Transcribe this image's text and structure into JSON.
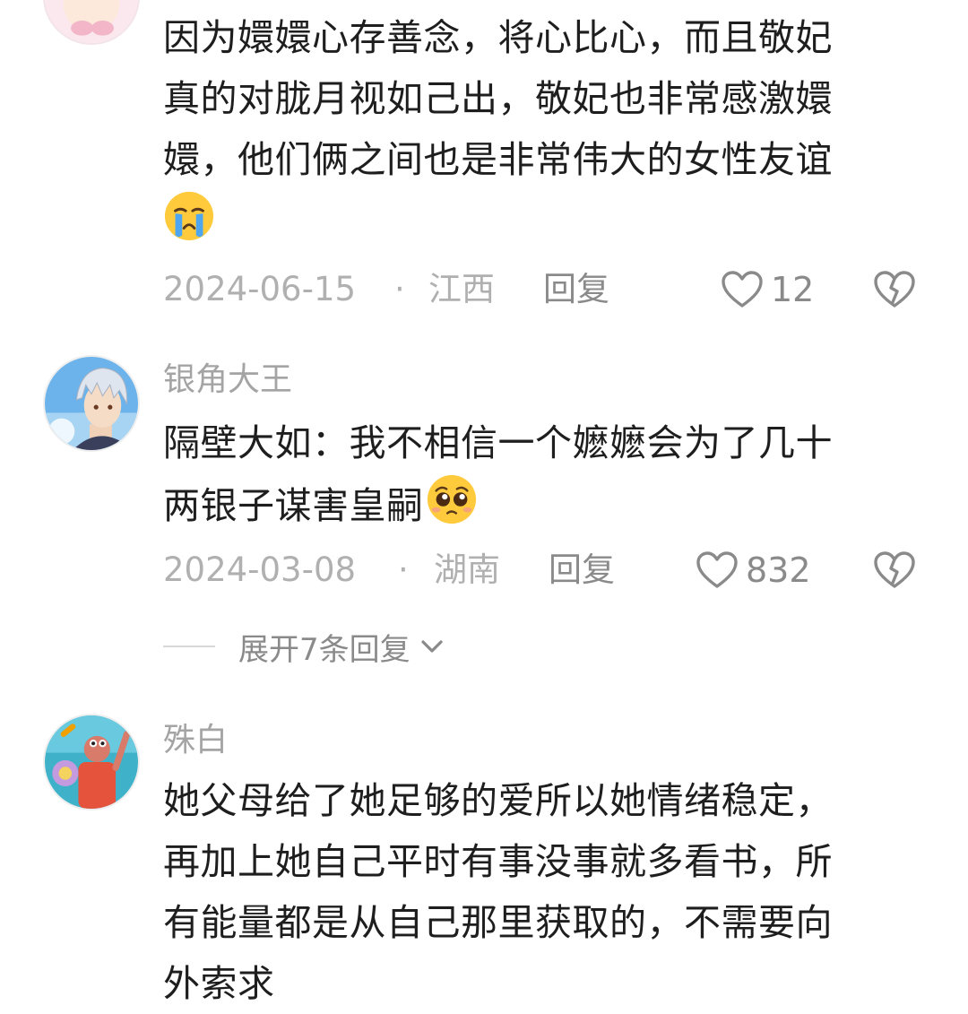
{
  "comments": [
    {
      "username": "",
      "text_lines": [
        "因为嬛嬛心存善念，将心比心，而且敬妃",
        "真的对胧月视如己出，敬妃也非常感激嬛",
        "嬛，他们俩之间也是非常伟大的女性友谊"
      ],
      "emoji": "crying-face",
      "date": "2024-06-15",
      "separator": "·",
      "location": "江西",
      "reply_label": "回复",
      "likes": "12"
    },
    {
      "username": "银角大王",
      "text_lines": [
        "隔壁大如：我不相信一个嬷嬷会为了几十",
        "两银子谋害皇嗣"
      ],
      "emoji": "pleading-face",
      "date": "2024-03-08",
      "separator": "·",
      "location": "湖南",
      "reply_label": "回复",
      "likes": "832",
      "expand_label": "展开7条回复"
    },
    {
      "username": "殊白",
      "text_lines": [
        "她父母给了她足够的爱所以她情绪稳定，",
        "再加上她自己平时有事没事就多看书，所",
        "有能量都是从自己那里获取的，不需要向",
        "外索求"
      ]
    }
  ],
  "icons": {
    "like": "heart-outline-icon",
    "dislike": "broken-heart-icon",
    "expand": "chevron-down-icon"
  },
  "colors": {
    "text": "#1e1e1e",
    "muted": "#a4a4a4",
    "action": "#8a8a8a"
  }
}
